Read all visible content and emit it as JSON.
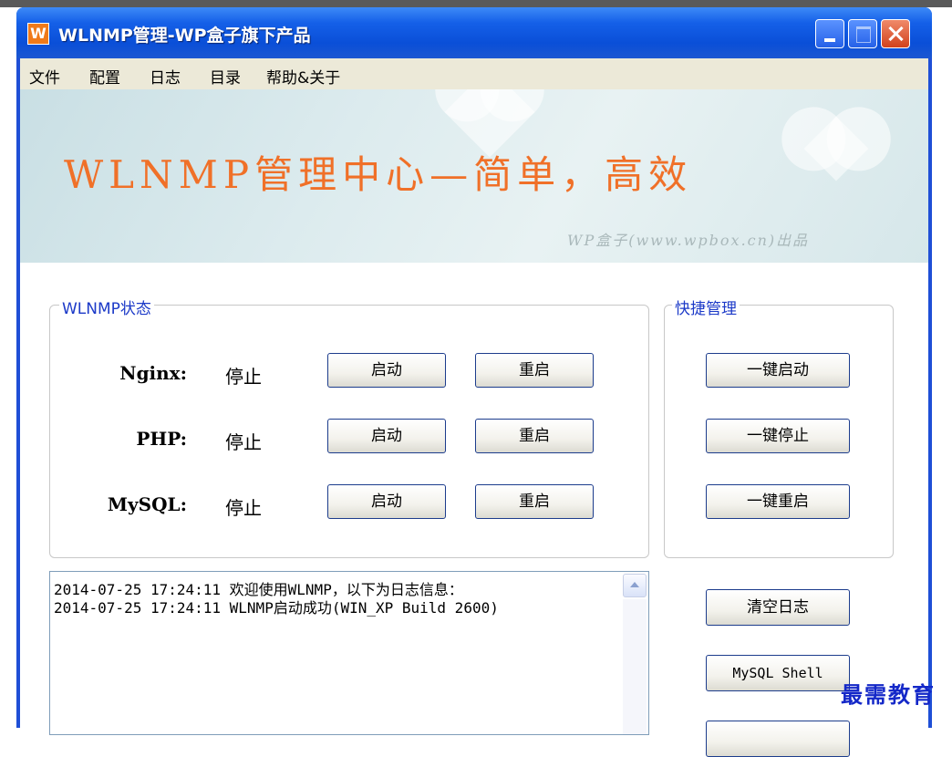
{
  "window": {
    "icon_glyph": "W",
    "title": "WLNMP管理-WP盒子旗下产品"
  },
  "menu": [
    "文件",
    "配置",
    "日志",
    "目录",
    "帮助&关于"
  ],
  "banner": {
    "title": "WLNMP管理中心—简单，高效",
    "subtitle": "WP盒子(www.wpbox.cn)出品"
  },
  "status_group": {
    "legend": "WLNMP状态",
    "services": [
      {
        "name": "Nginx:",
        "status": "停止",
        "start_label": "启动",
        "restart_label": "重启"
      },
      {
        "name": "PHP:",
        "status": "停止",
        "start_label": "启动",
        "restart_label": "重启"
      },
      {
        "name": "MySQL:",
        "status": "停止",
        "start_label": "启动",
        "restart_label": "重启"
      }
    ]
  },
  "quick_group": {
    "legend": "快捷管理",
    "buttons": [
      "一键启动",
      "一键停止",
      "一键重启"
    ]
  },
  "log": {
    "lines": [
      "2014-07-25 17:24:11  欢迎使用WLNMP，以下为日志信息：",
      "2014-07-25 17:24:11  WLNMP启动成功(WIN_XP Build 2600)"
    ]
  },
  "side_buttons": {
    "clear_log": "清空日志",
    "mysql_shell": "MySQL Shell"
  },
  "watermark": "最需教育",
  "colors": {
    "titlebar": "#0a4fd8",
    "legend_text": "#1c3ac8",
    "banner_text": "#f07028",
    "watermark": "#1428c8"
  }
}
